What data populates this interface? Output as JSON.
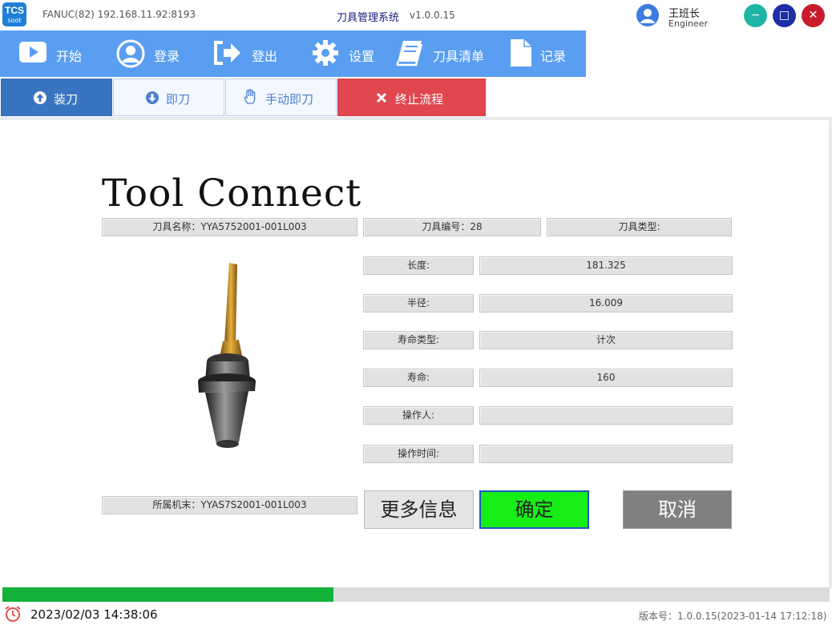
{
  "titlebar": {
    "logo_line1": "TCS",
    "logo_line2": "soot",
    "connection": "FANUC(82) 192.168.11.92:8193",
    "app_title": "刀具管理系统",
    "version": "v1.0.0.15",
    "user_name": "王班长",
    "user_role": "Engineer",
    "minimize": "−",
    "maximize": "□",
    "close": "✕"
  },
  "nav": {
    "start": "开始",
    "login": "登录",
    "logout": "登出",
    "settings": "设置",
    "tool_list": "刀具清单",
    "records": "记录"
  },
  "subbar": {
    "load": "装刀",
    "unload": "即刀",
    "manual_unload": "手动即刀",
    "stop": "终止流程"
  },
  "main": {
    "heading": "Tool Connect",
    "tool_name": "刀具名称：YYA5752001-001L003",
    "tool_number": "刀具编号：28",
    "tool_type": "刀具类型:",
    "owner_machine": "所属机末：YYAS7S2001-001L003",
    "rows": [
      {
        "label": "长度:",
        "value": "181.325"
      },
      {
        "label": "半径:",
        "value": "16.009"
      },
      {
        "label": "寿命类型:",
        "value": "计次"
      },
      {
        "label": "寿命:",
        "value": "160"
      },
      {
        "label": "操作人:",
        "value": ""
      },
      {
        "label": "操作时间:",
        "value": ""
      }
    ],
    "more_info": "更多信息",
    "confirm": "确定",
    "cancel": "取消"
  },
  "progress": {
    "value_percent": 40
  },
  "status": {
    "datetime": "2023/02/03 14:38:06",
    "build": "版本号：1.0.0.15(2023-01-14 17:12:18)"
  },
  "colors": {
    "accent": "#5a9ef2",
    "load_button": "#3974c0",
    "stop_button": "#e0474f",
    "confirm_button": "#16ee16",
    "progress": "#11b13a"
  },
  "icons": {
    "start": "play-icon",
    "login": "user-icon",
    "logout": "logout-icon",
    "settings": "gear-icon",
    "tool_list": "book-icon",
    "records": "document-icon",
    "load": "arrow-up-icon",
    "unload": "arrow-down-icon",
    "manual_unload": "hand-icon",
    "stop": "x-icon",
    "clock": "alarm-clock-icon"
  }
}
